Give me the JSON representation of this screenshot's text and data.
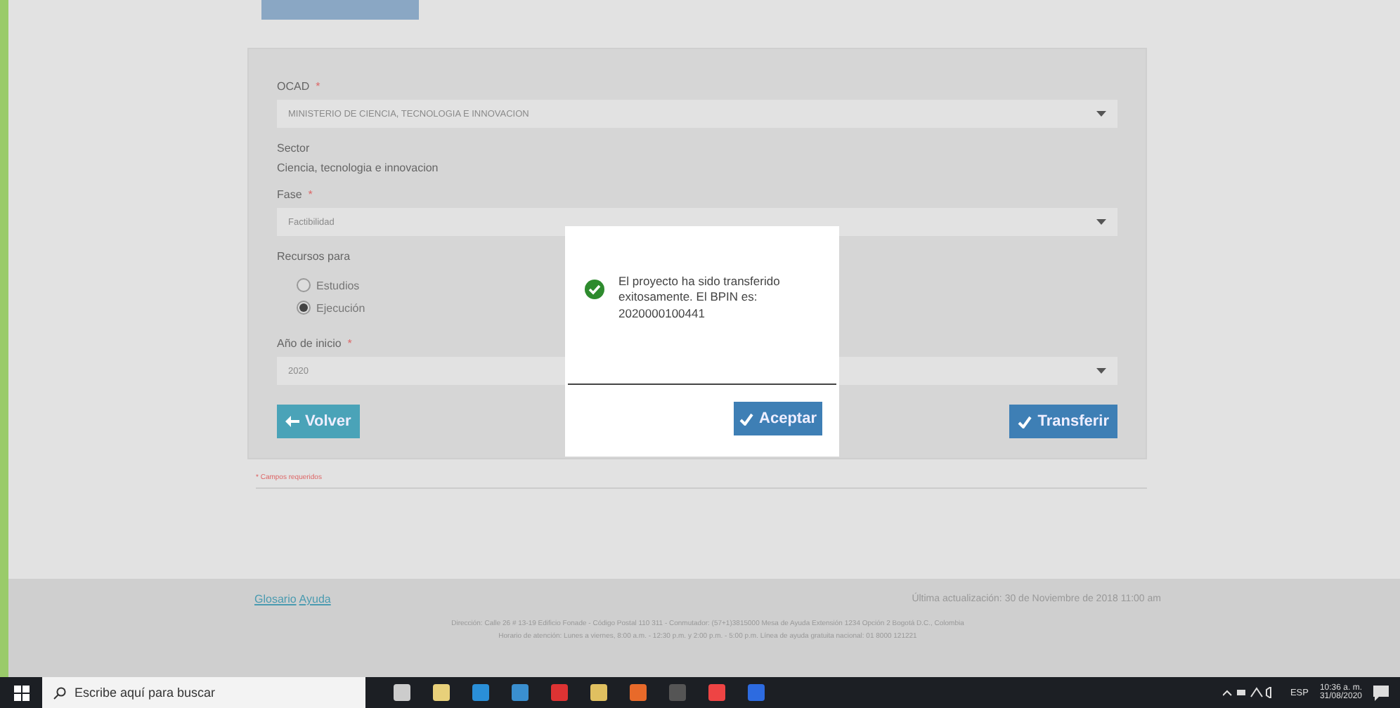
{
  "form": {
    "fields": [
      {
        "kind": "select",
        "label": "OCAD",
        "required_mark": "*",
        "value": "MINISTERIO DE CIENCIA, TECNOLOGIA E INNOVACION"
      },
      {
        "kind": "text",
        "label": "Sector",
        "value": "Ciencia, tecnologia e innovacion"
      },
      {
        "kind": "select",
        "label": "Fase",
        "required_mark": "*",
        "value": "Factibilidad"
      },
      {
        "kind": "radio",
        "label": "Recursos para",
        "options": [
          {
            "label": "Estudios",
            "selected": false
          },
          {
            "label": "Ejecución",
            "selected": true
          }
        ]
      },
      {
        "kind": "select",
        "label": "Año de inicio",
        "required_mark": "*",
        "value": "2020"
      }
    ],
    "back_button": "Volver",
    "submit_button": "Transferir",
    "required_note": "* Campos requeridos"
  },
  "dialog": {
    "message": "El proyecto ha sido transferido exitosamente. El BPIN es: 2020000100441",
    "button": "Aceptar"
  },
  "footer": {
    "links": [
      "Glosario",
      "Ayuda"
    ],
    "updated": "Última actualización: 30 de Noviembre de 2018 11:00 am",
    "address": "Dirección: Calle 26 # 13-19 Edificio Fonade - Código Postal 110 311 - Conmutador: (57+1)3815000 Mesa de Ayuda Extensión 1234 Opción 2 Bogotá D.C., Colombia",
    "hours": "Horario de atención: Lunes a viernes, 8:00 a.m. - 12:30 p.m. y 2:00 p.m. - 5:00 p.m. Línea de ayuda gratuita nacional: 01 8000 121221"
  },
  "taskbar": {
    "search_placeholder": "Escribe aquí para buscar",
    "language": "ESP",
    "time": "10:36 a. m.",
    "date": "31/08/2020"
  }
}
